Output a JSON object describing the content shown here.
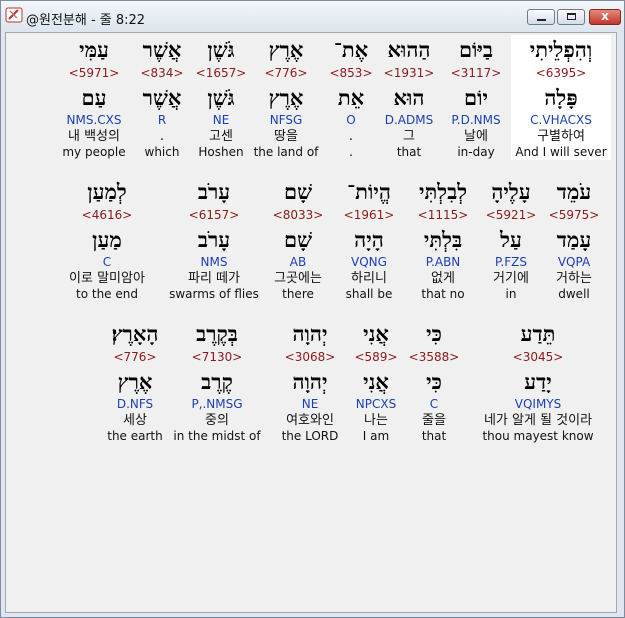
{
  "window": {
    "title": "@원전분해 - 줄 8:22",
    "close_glyph": "x"
  },
  "rows": [
    [
      {
        "hebrew": "וְהִפְלֵיתִי",
        "strong": "<6395>",
        "lemma": "פָּלָה",
        "morph": "C.VHACXS",
        "korean": "구별하여",
        "english": "And I will sever"
      },
      {
        "hebrew": "בַיּוֹם",
        "strong": "<3117>",
        "lemma": "יוֹם",
        "morph": "P.D.NMS",
        "korean": "날에",
        "english": "in-day"
      },
      {
        "hebrew": "הַהוּא",
        "strong": "<1931>",
        "lemma": "הוּא",
        "morph": "D.ADMS",
        "korean": "그",
        "english": "that"
      },
      {
        "hebrew": "אֶת־",
        "strong": "<853>",
        "lemma": "אֵת",
        "morph": "O",
        "korean": ".",
        "english": "."
      },
      {
        "hebrew": "אֶרֶץ",
        "strong": "<776>",
        "lemma": "אֶרֶץ",
        "morph": "NFSG",
        "korean": "땅을",
        "english": "the land of"
      },
      {
        "hebrew": "גֹּשֶׁן",
        "strong": "<1657>",
        "lemma": "גֹּשֶׁן",
        "morph": "NE",
        "korean": "고센",
        "english": "Hoshen"
      },
      {
        "hebrew": "אֲשֶׁר",
        "strong": "<834>",
        "lemma": "אֲשֶׁר",
        "morph": "R",
        "korean": ".",
        "english": "which"
      },
      {
        "hebrew": "עַמִּי",
        "strong": "<5971>",
        "lemma": "עַם",
        "morph": "NMS.CXS",
        "korean": "내 백성의",
        "english": "my people"
      }
    ],
    [
      {
        "hebrew": "עֹמֵד",
        "strong": "<5975>",
        "lemma": "עָמַד",
        "morph": "VQPA",
        "korean": "거하는",
        "english": "dwell"
      },
      {
        "hebrew": "עָלֶיהָ",
        "strong": "<5921>",
        "lemma": "עַל",
        "morph": "P.FZS",
        "korean": "거기에",
        "english": "in"
      },
      {
        "hebrew": "לְבִלְתִּי",
        "strong": "<1115>",
        "lemma": "בִּלְתִּי",
        "morph": "P.ABN",
        "korean": "없게",
        "english": "that no"
      },
      {
        "hebrew": "הֱיוֹת־",
        "strong": "<1961>",
        "lemma": "הָיָה",
        "morph": "VQNG",
        "korean": "하리니",
        "english": "shall be"
      },
      {
        "hebrew": "שָׁם",
        "strong": "<8033>",
        "lemma": "שָׁם",
        "morph": "AB",
        "korean": "그곳에는",
        "english": "there"
      },
      {
        "hebrew": "עָרֹב",
        "strong": "<6157>",
        "lemma": "עָרֹב",
        "morph": "NMS",
        "korean": "파리 떼가",
        "english": "swarms of flies"
      },
      {
        "hebrew": "לְמַעַן",
        "strong": "<4616>",
        "lemma": "מַעַן",
        "morph": "C",
        "korean": "이로 말미암아",
        "english": "to the end"
      }
    ],
    [
      {
        "hebrew": "תֵּדַע",
        "strong": "<3045>",
        "lemma": "יָדַע",
        "morph": "VQIMYS",
        "korean": "네가 알게 될 것이라",
        "english": "thou mayest know"
      },
      {
        "hebrew": "כִּי",
        "strong": "<3588>",
        "lemma": "כִּי",
        "morph": "C",
        "korean": "줄을",
        "english": "that"
      },
      {
        "hebrew": "אֲנִי",
        "strong": "<589>",
        "lemma": "אֲנִי",
        "morph": "NPCXS",
        "korean": "나는",
        "english": "I am"
      },
      {
        "hebrew": "יְהוָה",
        "strong": "<3068>",
        "lemma": "יְהוָה",
        "morph": "NE",
        "korean": "여호와인",
        "english": "the LORD"
      },
      {
        "hebrew": "בְּקֶרֶב",
        "strong": "<7130>",
        "lemma": "קֶרֶב",
        "morph": "P,.NMSG",
        "korean": "중의",
        "english": "in the midst of"
      },
      {
        "hebrew": "הָאָרֶץ׃",
        "strong": "<776>",
        "lemma": "אֶרֶץ",
        "morph": "D.NFS",
        "korean": "세상",
        "english": "the earth"
      }
    ]
  ]
}
